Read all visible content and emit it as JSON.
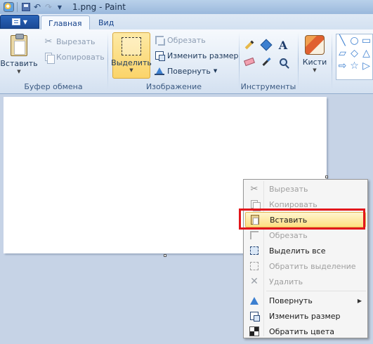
{
  "window": {
    "title": "1.png - Paint"
  },
  "tabs": [
    {
      "label": "Главная",
      "active": true
    },
    {
      "label": "Вид",
      "active": false
    }
  ],
  "ribbon": {
    "clipboard": {
      "group_label": "Буфер обмена",
      "paste_label": "Вставить",
      "cut_label": "Вырезать",
      "copy_label": "Копировать"
    },
    "image": {
      "group_label": "Изображение",
      "select_label": "Выделить",
      "crop_label": "Обрезать",
      "resize_label": "Изменить размер",
      "rotate_label": "Повернуть"
    },
    "tools": {
      "group_label": "Инструменты",
      "items": [
        "pencil-icon",
        "fill-bucket-icon",
        "text-icon",
        "eraser-icon",
        "color-picker-icon",
        "magnifier-icon"
      ]
    },
    "brushes": {
      "label": "Кисти"
    },
    "shapes": [
      "╲",
      "○",
      "▭",
      "▱",
      "◇",
      "△",
      "⇨",
      "☆",
      "▷"
    ]
  },
  "context_menu": {
    "items": [
      {
        "label": "Вырезать",
        "icon": "scissors-icon",
        "disabled": true
      },
      {
        "label": "Копировать",
        "icon": "copy-icon",
        "disabled": true
      },
      {
        "label": "Вставить",
        "icon": "paste-icon",
        "disabled": false,
        "highlighted": true
      },
      {
        "label": "Обрезать",
        "icon": "crop-icon",
        "disabled": true
      },
      {
        "label": "Выделить все",
        "icon": "select-all-icon",
        "disabled": false
      },
      {
        "label": "Обратить выделение",
        "icon": "invert-selection-icon",
        "disabled": true
      },
      {
        "label": "Удалить",
        "icon": "delete-icon",
        "disabled": true
      },
      {
        "label": "Повернуть",
        "icon": "rotate-icon",
        "disabled": false,
        "submenu": true
      },
      {
        "label": "Изменить размер",
        "icon": "resize-icon",
        "disabled": false
      },
      {
        "label": "Обратить цвета",
        "icon": "invert-colors-icon",
        "disabled": false
      }
    ]
  },
  "colors": {
    "highlight_border": "#e2171c",
    "accent": "#2a64b8"
  }
}
